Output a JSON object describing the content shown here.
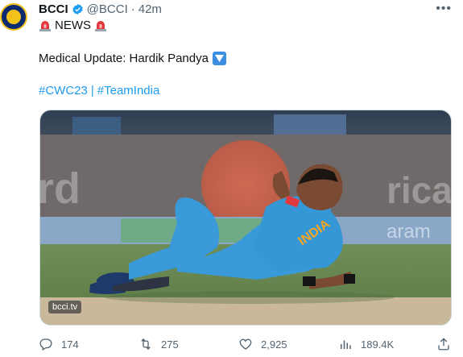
{
  "tweet": {
    "author_name": "BCCI",
    "handle": "@BCCI",
    "separator": "·",
    "time": "42m",
    "line1_text": "NEWS",
    "line2_text": "Medical Update: Hardik Pandya",
    "hashtags": [
      "#CWC23",
      "#TeamIndia"
    ],
    "hashtag_separator": "|"
  },
  "media": {
    "watermark": "bcci.tv",
    "jersey_text": "INDIA",
    "board_text": "rd",
    "board_text_right": "rica",
    "board_text_lower": "aram"
  },
  "actions": {
    "replies": "174",
    "reposts": "275",
    "likes": "2,925",
    "views": "189.4K"
  },
  "colors": {
    "link": "#1d9bf0",
    "secondary_text": "#536471",
    "verified_badge": "#1d9bf0",
    "jersey": "#3a9ad9"
  },
  "icons": [
    "verified-badge-icon",
    "more-icon",
    "siren-icon",
    "down-arrow-button-icon",
    "reply-icon",
    "repost-icon",
    "like-icon",
    "views-icon",
    "share-icon"
  ]
}
